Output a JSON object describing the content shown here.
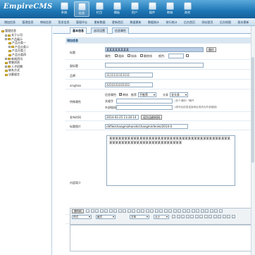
{
  "brand": {
    "name": "EmpireCMS",
    "suffix": ""
  },
  "top_nav": [
    {
      "label": "系统",
      "icon": "system-icon"
    },
    {
      "label": "信息",
      "icon": "info-icon"
    },
    {
      "label": "栏目",
      "icon": "column-icon"
    },
    {
      "label": "模板",
      "icon": "template-icon"
    },
    {
      "label": "用户",
      "icon": "user-icon"
    },
    {
      "label": "插件",
      "icon": "plugin-icon"
    },
    {
      "label": "商城",
      "icon": "shop-icon"
    },
    {
      "label": "其他",
      "icon": "other-icon"
    }
  ],
  "menu": [
    "增加信息",
    "管理信息",
    "审核信息",
    "签发信息",
    "管理评论",
    "更新数据",
    "更新首页",
    "数据更新",
    "数据统计",
    "排行统计",
    "后台首页",
    "网站首页",
    "后台地图",
    "版本更新"
  ],
  "sidebar": {
    "root": "管理信息",
    "items": [
      {
        "label": "关于公司",
        "indent": 1,
        "expand": "+"
      },
      {
        "label": "产品展示",
        "indent": 1,
        "expand": "-"
      },
      {
        "label": "产品分类一",
        "indent": 2,
        "expand": ""
      },
      {
        "label": "产品分类二",
        "indent": 2,
        "expand": "+"
      },
      {
        "label": "产品分类三",
        "indent": 2,
        "expand": ""
      },
      {
        "label": "产品分类四",
        "indent": 2,
        "expand": ""
      },
      {
        "label": "新闻资讯",
        "indent": 1,
        "expand": "+"
      },
      {
        "label": "荣誉资质",
        "indent": 1,
        "expand": ""
      },
      {
        "label": "人才招聘",
        "indent": 1,
        "expand": "+"
      },
      {
        "label": "联系方式",
        "indent": 1,
        "expand": ""
      },
      {
        "label": "访客留言",
        "indent": 1,
        "expand": ""
      }
    ]
  },
  "tabs": [
    "基本信息",
    "选项设置",
    "信息属性"
  ],
  "form": {
    "section": "增加信息",
    "title": {
      "label": "标题",
      "value": "某某某某某某某某",
      "btn": "图片"
    },
    "title_attr": {
      "label": "属性:",
      "opts": [
        "粗体",
        "斜体",
        "删除线"
      ],
      "color_label": "颜色:"
    },
    "subtitle": {
      "label": "副标题",
      "value": ""
    },
    "brand": {
      "label": "品牌",
      "value": "1111111111111"
    },
    "xinghao": {
      "label": "xinghao",
      "value": "2222222222222"
    },
    "special": {
      "label": "特殊属性",
      "info_attr": "信息属性:",
      "chk1": "审核",
      "chk2": "推荐",
      "sel1": "不推荐",
      "chk3": "头条",
      "sel2": "非头条",
      "kw_label": "关键字",
      "kw_note": "(多个请用\",\"隔开",
      "link_label": "外部链接",
      "link_note": "(填写后信息连接地址将改为外部链接)"
    },
    "time": {
      "label": "发布时间",
      "value": "2014-03-25 13:30:14",
      "btn": "设为当前时间"
    },
    "img": {
      "label": "标题图片",
      "value": "/d/file/changmizhanshi/changminfenlei/2014-0"
    },
    "summary": {
      "label": "内容简介",
      "value": "某某某某某某某某某某某某某某某某某某某某某某某某某某某某某某某某某某某某某某某某某某某某某某某某某某某某某某某某某某某某某某某某"
    },
    "author": {
      "label": "作者",
      "sel": "选择作者",
      "btn": "增加作者"
    },
    "source": {
      "label": "信息来源",
      "sel": "选择信息来源",
      "btn": "增加来源"
    },
    "content": {
      "label": "商品正文"
    }
  },
  "editor": {
    "mode": "源代码",
    "style": "样式",
    "format": "格式",
    "font": "字体",
    "size": "大小"
  },
  "colors": {
    "topbar": "#1d76b5",
    "accent": "#5ba9da"
  }
}
